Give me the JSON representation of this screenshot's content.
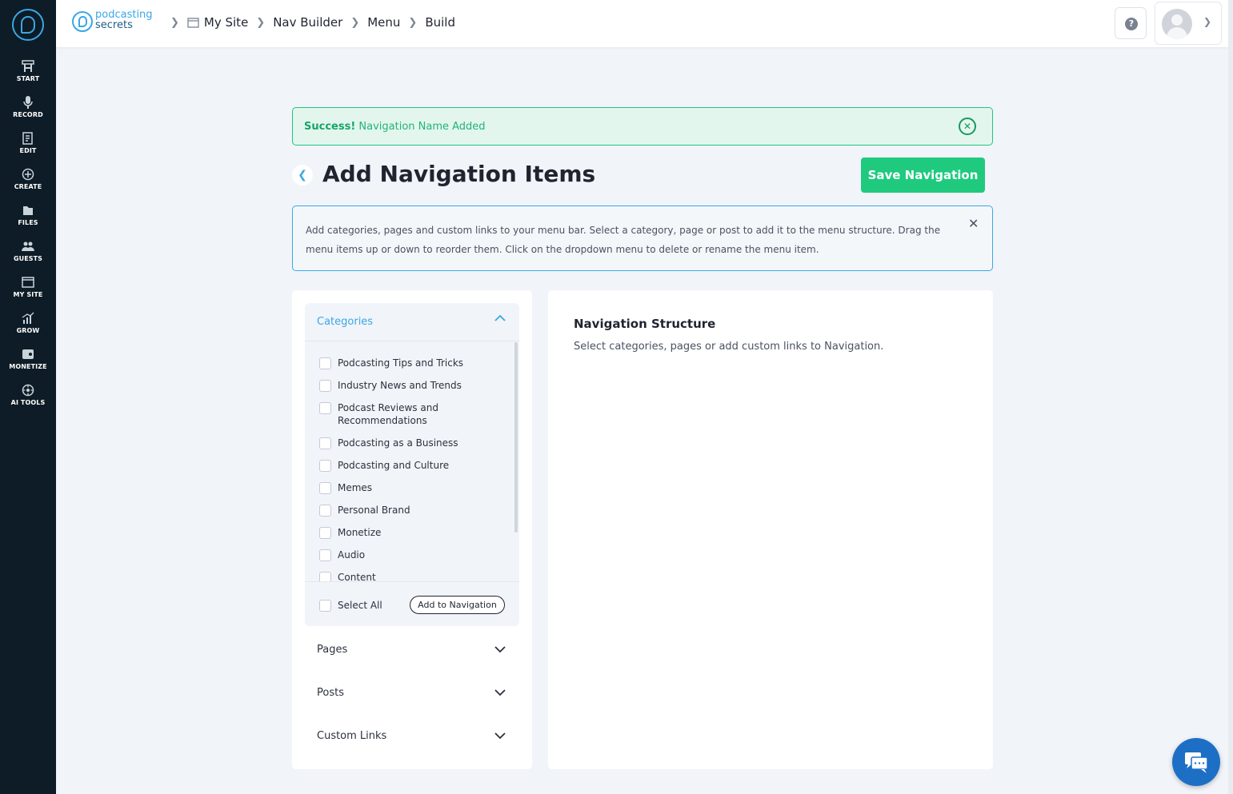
{
  "sidebar": {
    "items": [
      {
        "label": "START",
        "icon": "start-icon"
      },
      {
        "label": "RECORD",
        "icon": "microphone-icon"
      },
      {
        "label": "EDIT",
        "icon": "edit-icon"
      },
      {
        "label": "CREATE",
        "icon": "create-icon"
      },
      {
        "label": "FILES",
        "icon": "files-icon"
      },
      {
        "label": "GUESTS",
        "icon": "guests-icon"
      },
      {
        "label": "MY SITE",
        "icon": "my-site-icon"
      },
      {
        "label": "GROW",
        "icon": "grow-icon"
      },
      {
        "label": "MONETIZE",
        "icon": "monetize-icon"
      },
      {
        "label": "AI TOOLS",
        "icon": "ai-tools-icon"
      }
    ]
  },
  "header": {
    "brand_line1": "podcasting",
    "brand_line2": "secrets",
    "breadcrumbs": [
      "My Site",
      "Nav Builder",
      "Menu",
      "Build"
    ],
    "help_label": "?"
  },
  "alert": {
    "strong": "Success!",
    "message": "Navigation Name Added",
    "color": "#1ec67e"
  },
  "page": {
    "title": "Add Navigation Items",
    "save_label": "Save Navigation",
    "accent": "#3aa7e6",
    "save_color": "#1fca7f"
  },
  "info": {
    "text": "Add categories, pages and custom links to your menu bar. Select a category, page or post to add it to the menu structure. Drag the menu items up or down to reorder them. Click on the dropdown menu to delete or rename the menu item."
  },
  "categories": {
    "title": "Categories",
    "items": [
      "Podcasting Tips and Tricks",
      "Industry News and Trends",
      "Podcast Reviews and Recommendations",
      "Podcasting as a Business",
      "Podcasting and Culture",
      "Memes",
      "Personal Brand",
      "Monetize",
      "Audio",
      "Content"
    ],
    "select_all": "Select All",
    "add_button": "Add to Navigation"
  },
  "accordions": [
    "Pages",
    "Posts",
    "Custom Links"
  ],
  "structure": {
    "title": "Navigation Structure",
    "subtitle": "Select categories, pages or add custom links to Navigation."
  }
}
